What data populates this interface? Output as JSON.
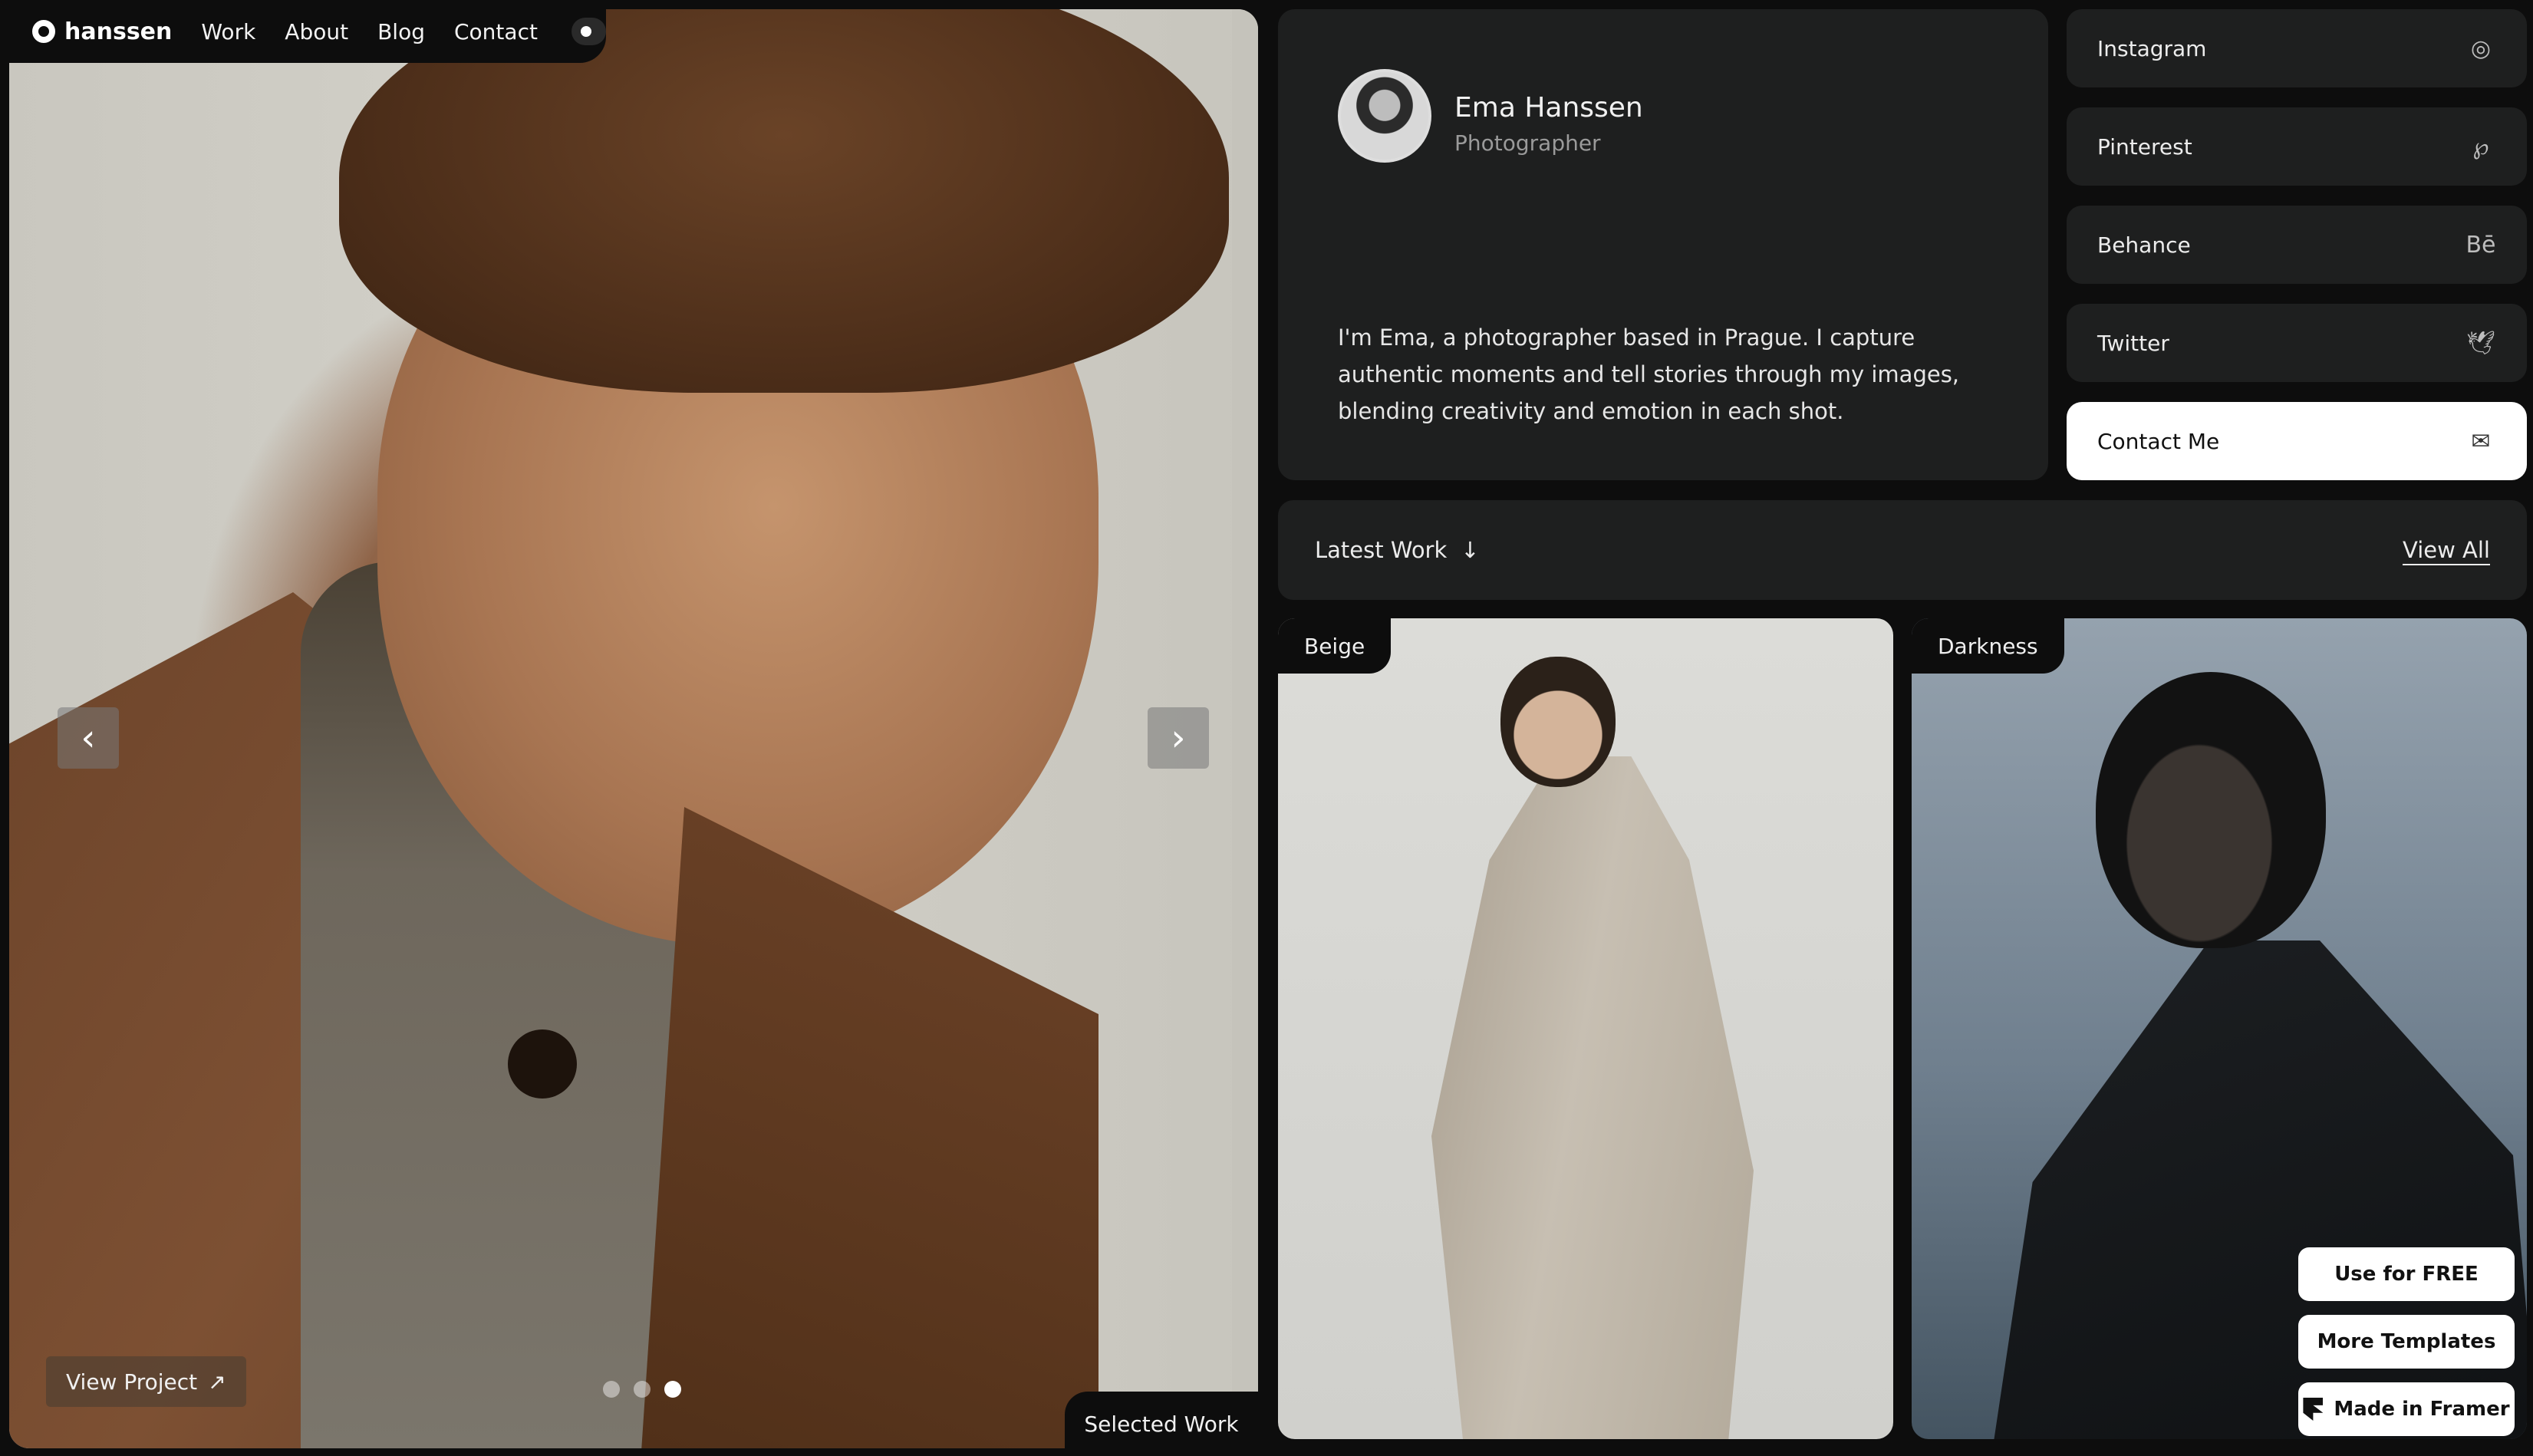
{
  "nav": {
    "brand": "hanssen",
    "links": [
      "Work",
      "About",
      "Blog",
      "Contact"
    ]
  },
  "hero": {
    "prev_icon": "chevron-left-icon",
    "next_icon": "chevron-right-icon",
    "view_project": "View Project",
    "view_project_icon": "↗",
    "slide_count": 3,
    "active_slide": 3,
    "selected_work": "Selected Work"
  },
  "profile": {
    "name": "Ema Hanssen",
    "role": "Photographer",
    "bio": "I'm Ema, a photographer based in Prague. I capture authentic moments and tell stories through my images, blending creativity and emotion in each shot."
  },
  "social": [
    {
      "label": "Instagram",
      "icon": "instagram-icon",
      "glyph": "◎"
    },
    {
      "label": "Pinterest",
      "icon": "pinterest-icon",
      "glyph": "℘"
    },
    {
      "label": "Behance",
      "icon": "behance-icon",
      "glyph": "Bē"
    },
    {
      "label": "Twitter",
      "icon": "twitter-icon",
      "glyph": "🕊"
    },
    {
      "label": "Contact Me",
      "icon": "mail-icon",
      "glyph": "✉"
    }
  ],
  "latest": {
    "label": "Latest Work",
    "arrow": "↓",
    "view_all": "View All"
  },
  "works": [
    {
      "title": "Beige"
    },
    {
      "title": "Darkness"
    }
  ],
  "badges": {
    "use_free": "Use for FREE",
    "more_templates": "More Templates",
    "made_in_framer": "Made in Framer"
  },
  "colors": {
    "background": "#0d0d0d",
    "card": "#1e1f1f",
    "accent_light": "#ffffff"
  }
}
